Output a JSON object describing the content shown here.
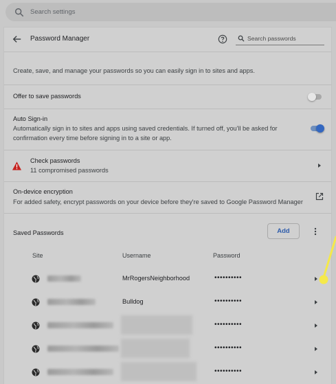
{
  "global_search": {
    "placeholder": "Search settings",
    "icon": "search-icon"
  },
  "header": {
    "title": "Password Manager",
    "back_icon": "arrow-left-icon",
    "help_icon": "help-circle-icon",
    "search_placeholder": "Search passwords"
  },
  "intro": "Create, save, and manage your passwords so you can easily sign in to sites and apps.",
  "offer_to_save": {
    "label": "Offer to save passwords",
    "enabled": false
  },
  "auto_signin": {
    "label": "Auto Sign-in",
    "description_line1": "Automatically sign in to sites and apps using saved credentials. If turned off, you'll be asked for",
    "description_line2": "confirmation every time before signing in to a site or app.",
    "enabled": true
  },
  "check_passwords": {
    "label": "Check passwords",
    "sublabel": "11 compromised passwords",
    "icon": "warning-triangle-icon"
  },
  "encryption": {
    "label": "On-device encryption",
    "description": "For added safety, encrypt passwords on your device before they're saved to Google Password Manager",
    "icon": "open-external-icon"
  },
  "saved_passwords": {
    "title": "Saved Passwords",
    "add_label": "Add",
    "columns": {
      "site": "Site",
      "username": "Username",
      "password": "Password"
    },
    "rows": [
      {
        "username": "MrRogersNeighborhood",
        "password": "••••••••••"
      },
      {
        "username": "Bulldog",
        "password": "••••••••••"
      },
      {
        "username": "",
        "password": "••••••••••"
      },
      {
        "username": "",
        "password": "••••••••••"
      },
      {
        "username": "",
        "password": "••••••••••"
      }
    ]
  },
  "colors": {
    "background": "#c9c9c9",
    "panel": "#d0d0d0",
    "accent": "#3367c0",
    "warning": "#c5221f",
    "annotation": "#f5e94a"
  }
}
